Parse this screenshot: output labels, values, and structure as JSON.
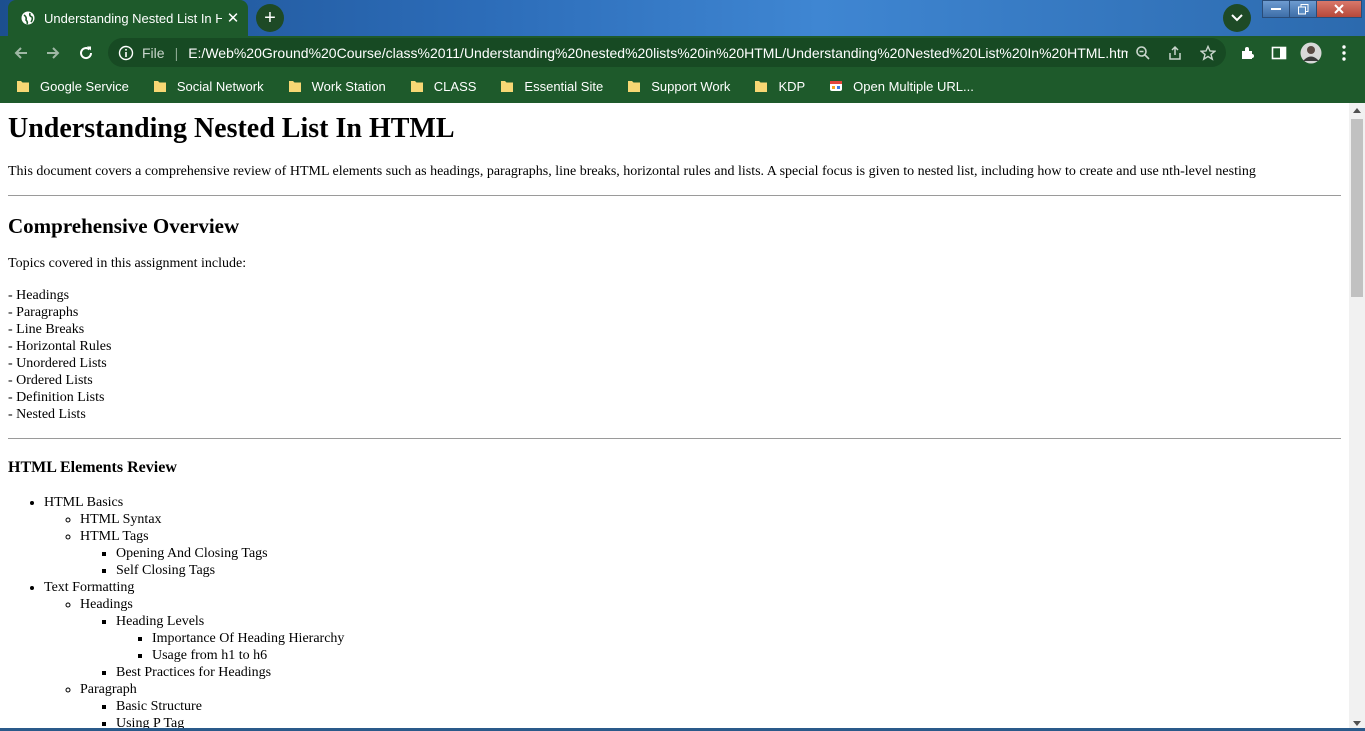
{
  "browser": {
    "tab_title": "Understanding Nested List In HTML",
    "address_scheme_label": "File",
    "address_url": "E:/Web%20Ground%20Course/class%2011/Understanding%20nested%20lists%20in%20HTML/Understanding%20Nested%20List%20In%20HTML.html",
    "colors": {
      "tab_strip": "#2c6cb8",
      "toolbar": "#1e5a2b",
      "omnibox": "#174a23"
    },
    "bookmarks": [
      {
        "label": "Google Service",
        "icon": "folder-icon"
      },
      {
        "label": "Social Network",
        "icon": "folder-icon"
      },
      {
        "label": "Work Station",
        "icon": "folder-icon"
      },
      {
        "label": "CLASS",
        "icon": "folder-icon"
      },
      {
        "label": "Essential Site",
        "icon": "folder-icon"
      },
      {
        "label": "Support Work",
        "icon": "folder-icon"
      },
      {
        "label": "KDP",
        "icon": "folder-icon"
      },
      {
        "label": "Open Multiple URL...",
        "icon": "app-icon"
      }
    ]
  },
  "page": {
    "title": "Understanding Nested List In HTML",
    "intro": "This document covers a comprehensive review of HTML elements such as headings, paragraphs, line breaks, horizontal rules and lists. A special focus is given to nested list, including how to create and use nth-level nesting",
    "overview_heading": "Comprehensive Overview",
    "topics_intro": "Topics covered in this assignment include:",
    "topics": [
      "- Headings",
      "- Paragraphs",
      "- Line Breaks",
      "- Horizontal Rules",
      "- Unordered Lists",
      "- Ordered Lists",
      "- Definition Lists",
      "- Nested Lists"
    ],
    "review_heading": "HTML Elements Review",
    "review": {
      "basics": {
        "label": "HTML Basics",
        "syntax": "HTML Syntax",
        "tags": "HTML Tags",
        "tags_children": [
          "Opening And Closing Tags",
          "Self Closing Tags"
        ]
      },
      "formatting": {
        "label": "Text Formatting",
        "headings": "Headings",
        "heading_levels": "Heading Levels",
        "heading_levels_children": [
          "Importance Of Heading Hierarchy",
          "Usage from h1 to h6"
        ],
        "best_practices": "Best Practices for Headings",
        "paragraph": "Paragraph",
        "paragraph_children": [
          "Basic Structure",
          "Using P Tag"
        ]
      }
    }
  }
}
